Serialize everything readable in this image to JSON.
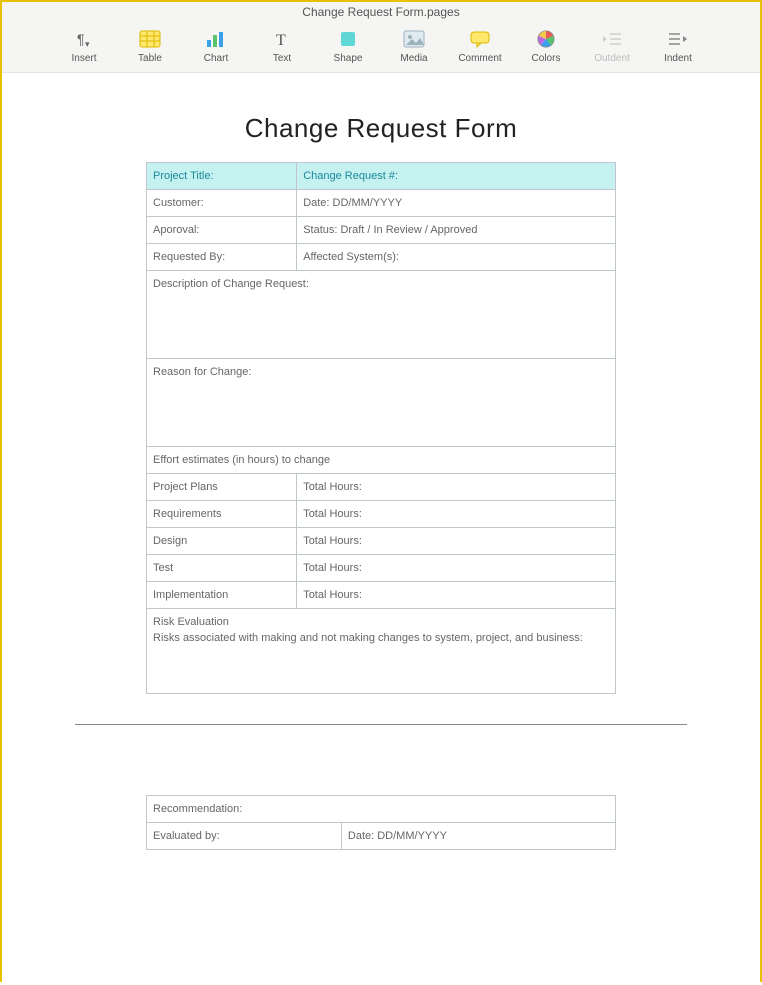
{
  "window": {
    "title": "Change Request Form.pages"
  },
  "toolbar": {
    "insert": "Insert",
    "table": "Table",
    "chart": "Chart",
    "text": "Text",
    "shape": "Shape",
    "media": "Media",
    "comment": "Comment",
    "colors": "Colors",
    "outdent": "Outdent",
    "indent": "Indent"
  },
  "doc": {
    "title": "Change Request Form",
    "row1": {
      "left": "Project Title:",
      "right": "Change Request #:"
    },
    "row2": {
      "left": "Customer:",
      "right": "Date: DD/MM/YYYY"
    },
    "row3": {
      "left": "Aporoval:",
      "right": "Status: Draft / In Review / Approved"
    },
    "row4": {
      "left": "Requested By:",
      "right": "Affected System(s):"
    },
    "desc": "Description of Change Request:",
    "reason": "Reason for Change:",
    "effort": "Effort estimates (in hours) to change",
    "est": [
      {
        "left": "Project Plans",
        "right": "Total Hours:"
      },
      {
        "left": "Requirements",
        "right": "Total Hours:"
      },
      {
        "left": "Design",
        "right": "Total Hours:"
      },
      {
        "left": "Test",
        "right": "Total Hours:"
      },
      {
        "left": "Implementation",
        "right": "Total Hours:"
      }
    ],
    "risk_title": "Risk Evaluation",
    "risk_body": "Risks associated with making and not making changes to system, project, and business:",
    "rec": "Recommendation:",
    "eval": {
      "left": "Evaluated by:",
      "right": "Date: DD/MM/YYYY"
    }
  }
}
